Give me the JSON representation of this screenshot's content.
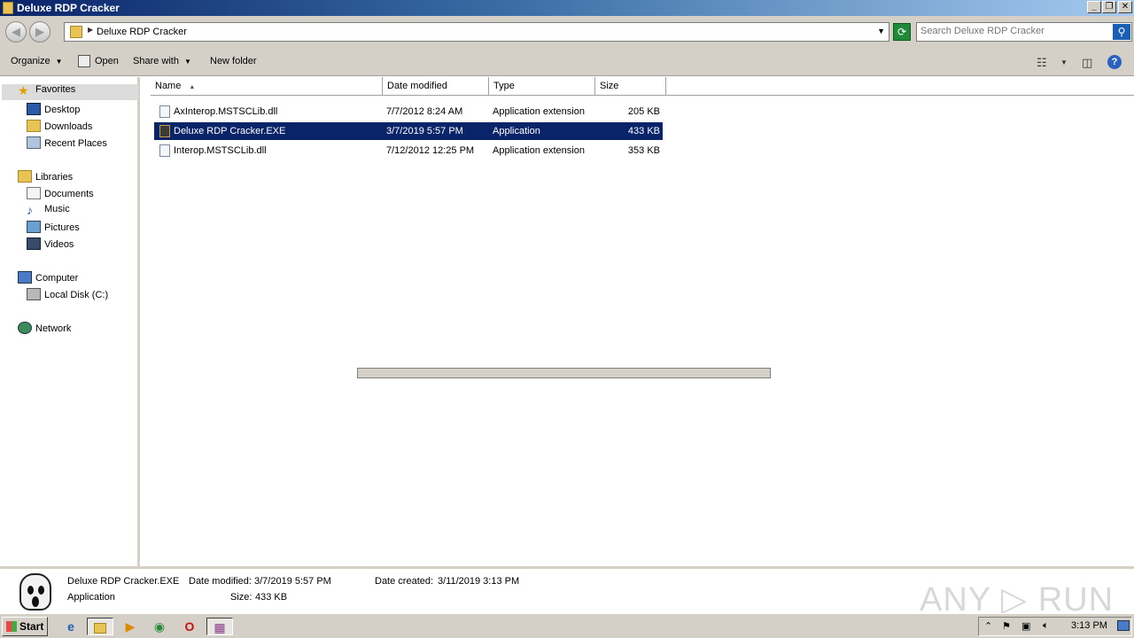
{
  "window": {
    "title": "Deluxe RDP Cracker",
    "minimize": "_",
    "restore": "❐",
    "close": "✕"
  },
  "address": {
    "back": "◀",
    "forward": "▶",
    "breadcrumb": "Deluxe RDP Cracker",
    "search_placeholder": "Search Deluxe RDP Cracker"
  },
  "toolbar": {
    "organize": "Organize",
    "open": "Open",
    "share_with": "Share with",
    "new_folder": "New folder"
  },
  "nav": {
    "favorites": "Favorites",
    "desktop": "Desktop",
    "downloads": "Downloads",
    "recent_places": "Recent Places",
    "libraries": "Libraries",
    "documents": "Documents",
    "music": "Music",
    "pictures": "Pictures",
    "videos": "Videos",
    "computer": "Computer",
    "local_disk": "Local Disk (C:)",
    "network": "Network"
  },
  "columns": {
    "name": "Name",
    "date_modified": "Date modified",
    "type": "Type",
    "size": "Size"
  },
  "files": [
    {
      "name": "AxInterop.MSTSCLib.dll",
      "date": "7/7/2012 8:24 AM",
      "type": "Application extension",
      "size": "205 KB",
      "icon": "dll-file-icon"
    },
    {
      "name": "Deluxe RDP Cracker.EXE",
      "date": "3/7/2019 5:57 PM",
      "type": "Application",
      "size": "433 KB",
      "icon": "scream-mask-icon"
    },
    {
      "name": "Interop.MSTSCLib.dll",
      "date": "7/12/2012 12:25 PM",
      "type": "Application extension",
      "size": "353 KB",
      "icon": "dll-file-icon"
    }
  ],
  "selected_index": 1,
  "details": {
    "filename": "Deluxe RDP Cracker.EXE",
    "date_modified_label": "Date modified:",
    "date_modified": "3/7/2019 5:57 PM",
    "date_created_label": "Date created:",
    "date_created": "3/11/2019 3:13 PM",
    "type": "Application",
    "size_label": "Size:",
    "size": "433 KB",
    "watermark": "ANY ▷ RUN"
  },
  "taskbar": {
    "start": "Start",
    "clock": "3:13 PM"
  },
  "colors": {
    "selection": "#0a246a",
    "chrome": "#d4d0c8"
  }
}
